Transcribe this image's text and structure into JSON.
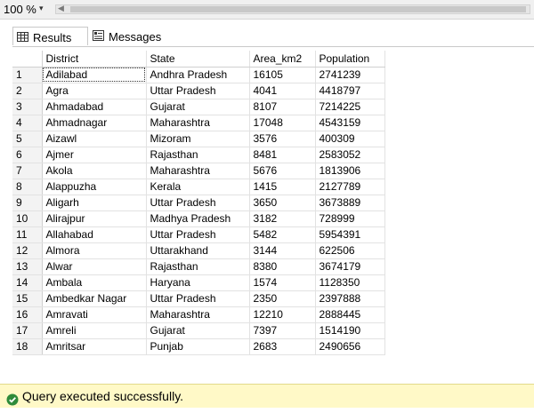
{
  "toolbar": {
    "zoom": "100 %",
    "zoom_arrow": "▾",
    "scroll_left_arrow": "◀"
  },
  "tabs": [
    {
      "label": "Results",
      "icon": "grid-icon"
    },
    {
      "label": "Messages",
      "icon": "messages-icon"
    }
  ],
  "grid": {
    "columns": [
      "District",
      "State",
      "Area_km2",
      "Population"
    ],
    "rows": [
      {
        "n": "1",
        "cells": [
          "Adilabad",
          "Andhra Pradesh",
          "16105",
          "2741239"
        ]
      },
      {
        "n": "2",
        "cells": [
          "Agra",
          "Uttar Pradesh",
          "4041",
          "4418797"
        ]
      },
      {
        "n": "3",
        "cells": [
          "Ahmadabad",
          "Gujarat",
          "8107",
          "7214225"
        ]
      },
      {
        "n": "4",
        "cells": [
          "Ahmadnagar",
          "Maharashtra",
          "17048",
          "4543159"
        ]
      },
      {
        "n": "5",
        "cells": [
          "Aizawl",
          "Mizoram",
          "3576",
          "400309"
        ]
      },
      {
        "n": "6",
        "cells": [
          "Ajmer",
          "Rajasthan",
          "8481",
          "2583052"
        ]
      },
      {
        "n": "7",
        "cells": [
          "Akola",
          "Maharashtra",
          "5676",
          "1813906"
        ]
      },
      {
        "n": "8",
        "cells": [
          "Alappuzha",
          "Kerala",
          "1415",
          "2127789"
        ]
      },
      {
        "n": "9",
        "cells": [
          "Aligarh",
          "Uttar Pradesh",
          "3650",
          "3673889"
        ]
      },
      {
        "n": "10",
        "cells": [
          "Alirajpur",
          "Madhya Pradesh",
          "3182",
          "728999"
        ]
      },
      {
        "n": "11",
        "cells": [
          "Allahabad",
          "Uttar Pradesh",
          "5482",
          "5954391"
        ]
      },
      {
        "n": "12",
        "cells": [
          "Almora",
          "Uttarakhand",
          "3144",
          "622506"
        ]
      },
      {
        "n": "13",
        "cells": [
          "Alwar",
          "Rajasthan",
          "8380",
          "3674179"
        ]
      },
      {
        "n": "14",
        "cells": [
          "Ambala",
          "Haryana",
          "1574",
          "1128350"
        ]
      },
      {
        "n": "15",
        "cells": [
          "Ambedkar Nagar",
          "Uttar Pradesh",
          "2350",
          "2397888"
        ]
      },
      {
        "n": "16",
        "cells": [
          "Amravati",
          "Maharashtra",
          "12210",
          "2888445"
        ]
      },
      {
        "n": "17",
        "cells": [
          "Amreli",
          "Gujarat",
          "7397",
          "1514190"
        ]
      },
      {
        "n": "18",
        "cells": [
          "Amritsar",
          "Punjab",
          "2683",
          "2490656"
        ]
      }
    ]
  },
  "status": {
    "message": "Query executed successfully.",
    "icon": "check-circle-icon",
    "color": "#fff9c7",
    "icon_color": "#2e8b3a"
  }
}
